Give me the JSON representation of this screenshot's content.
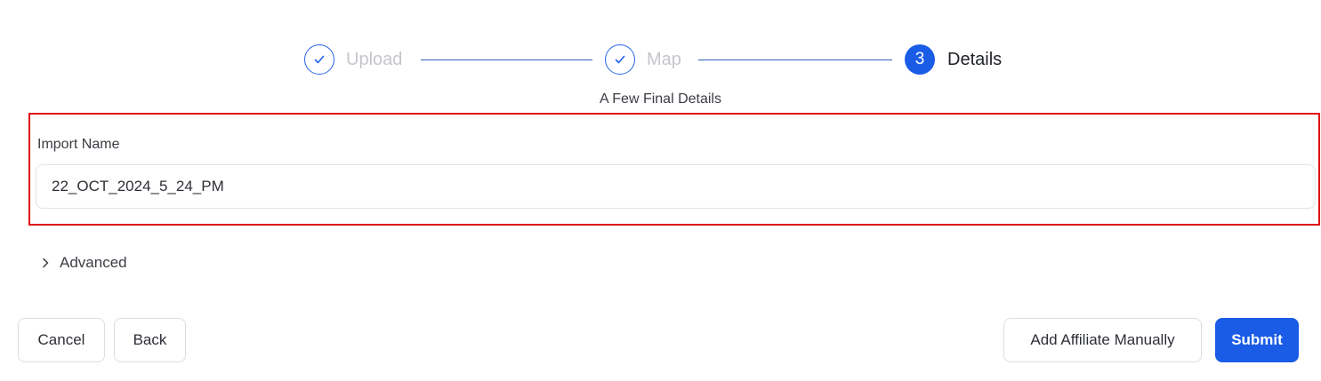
{
  "stepper": {
    "steps": [
      {
        "label": "Upload",
        "state": "done",
        "icon": "checkmark-icon"
      },
      {
        "label": "Map",
        "state": "done",
        "icon": "checkmark-icon"
      },
      {
        "label": "Details",
        "state": "active",
        "number": "3"
      }
    ]
  },
  "subtitle": "A Few Final Details",
  "form": {
    "import_name_label": "Import Name",
    "import_name_value": "22_OCT_2024_5_24_PM"
  },
  "advanced": {
    "label": "Advanced",
    "icon": "chevron-right-icon"
  },
  "buttons": {
    "cancel": "Cancel",
    "back": "Back",
    "add_affiliate": "Add Affiliate Manually",
    "submit": "Submit"
  },
  "colors": {
    "primary": "#1a5ce6",
    "highlight": "#e01010",
    "muted_label": "#c4c6cc"
  }
}
